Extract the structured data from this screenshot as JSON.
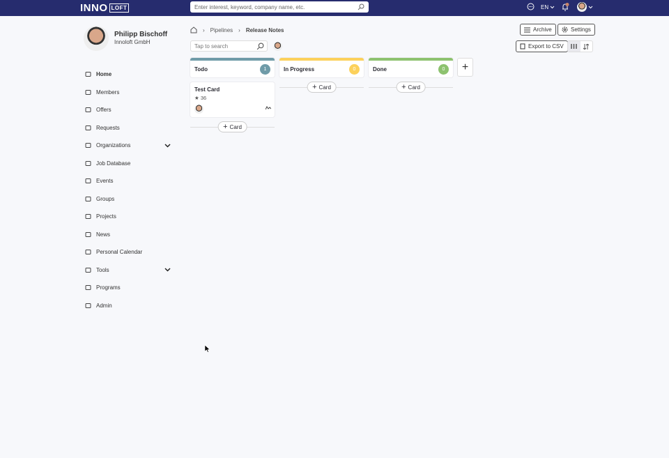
{
  "topbar": {
    "logo": "INNO",
    "logo_box": "LOFT",
    "search_placeholder": "Enter interest, keyword, company name, etc.",
    "language": "EN"
  },
  "user": {
    "name": "Philipp Bischoff",
    "org": "Innoloft GmbH"
  },
  "sidebar": {
    "items": [
      {
        "label": "Home",
        "icon": "home-icon",
        "active": true
      },
      {
        "label": "Members",
        "icon": "members-icon"
      },
      {
        "label": "Offers",
        "icon": "offers-icon"
      },
      {
        "label": "Requests",
        "icon": "megaphone-icon"
      },
      {
        "label": "Organizations",
        "icon": "organizations-icon",
        "expandable": true
      },
      {
        "label": "Job Database",
        "icon": "job-icon"
      },
      {
        "label": "Events",
        "icon": "events-icon"
      },
      {
        "label": "Groups",
        "icon": "groups-icon"
      },
      {
        "label": "Projects",
        "icon": "projects-icon"
      },
      {
        "label": "News",
        "icon": "news-icon"
      },
      {
        "label": "Personal Calendar",
        "icon": "calendar-icon"
      },
      {
        "label": "Tools",
        "icon": "tools-icon",
        "expandable": true
      },
      {
        "label": "Programs",
        "icon": "programs-icon"
      },
      {
        "label": "Admin",
        "icon": "admin-icon"
      }
    ]
  },
  "breadcrumb": [
    "Pipelines",
    "Release Notes"
  ],
  "board": {
    "search_placeholder": "Tap to search",
    "archive": "Archive",
    "settings": "Settings",
    "export": "Export to CSV",
    "add_card": "Card",
    "columns": [
      {
        "title": "Todo",
        "count": "1",
        "color": "#6f9ba8",
        "cards": [
          {
            "title": "Test Card",
            "stars": "36"
          }
        ]
      },
      {
        "title": "In Progress",
        "count": "0",
        "color": "#fcd15b",
        "cards": []
      },
      {
        "title": "Done",
        "count": "0",
        "color": "#8dc26f",
        "cards": []
      }
    ]
  }
}
